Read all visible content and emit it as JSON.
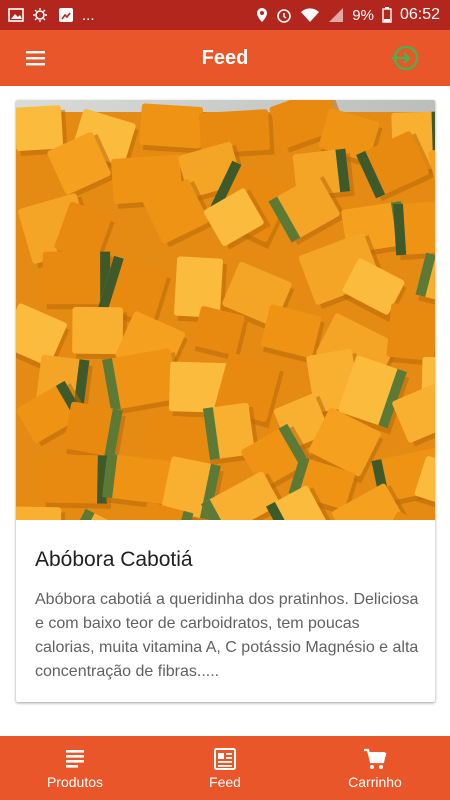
{
  "status_bar": {
    "battery": "9%",
    "time": "06:52",
    "overflow": "..."
  },
  "app_bar": {
    "title": "Feed"
  },
  "feed": {
    "items": [
      {
        "title": "Abóbora Cabotiá",
        "description": "Abóbora cabotiá a queridinha dos pratinhos. Deliciosa e com baixo teor de carboidratos, tem poucas calorias, muita vitamina A, C potássio Magnésio e alta concentração de fibras.....",
        "image": "cubed-pumpkin-photo"
      }
    ]
  },
  "bottom_nav": {
    "items": [
      {
        "label": "Produtos",
        "icon": "list-icon"
      },
      {
        "label": "Feed",
        "icon": "newspaper-icon"
      },
      {
        "label": "Carrinho",
        "icon": "cart-icon"
      }
    ]
  },
  "colors": {
    "status_bar": "#b3261e",
    "primary": "#e8562a",
    "login_icon": "#4caf50"
  }
}
